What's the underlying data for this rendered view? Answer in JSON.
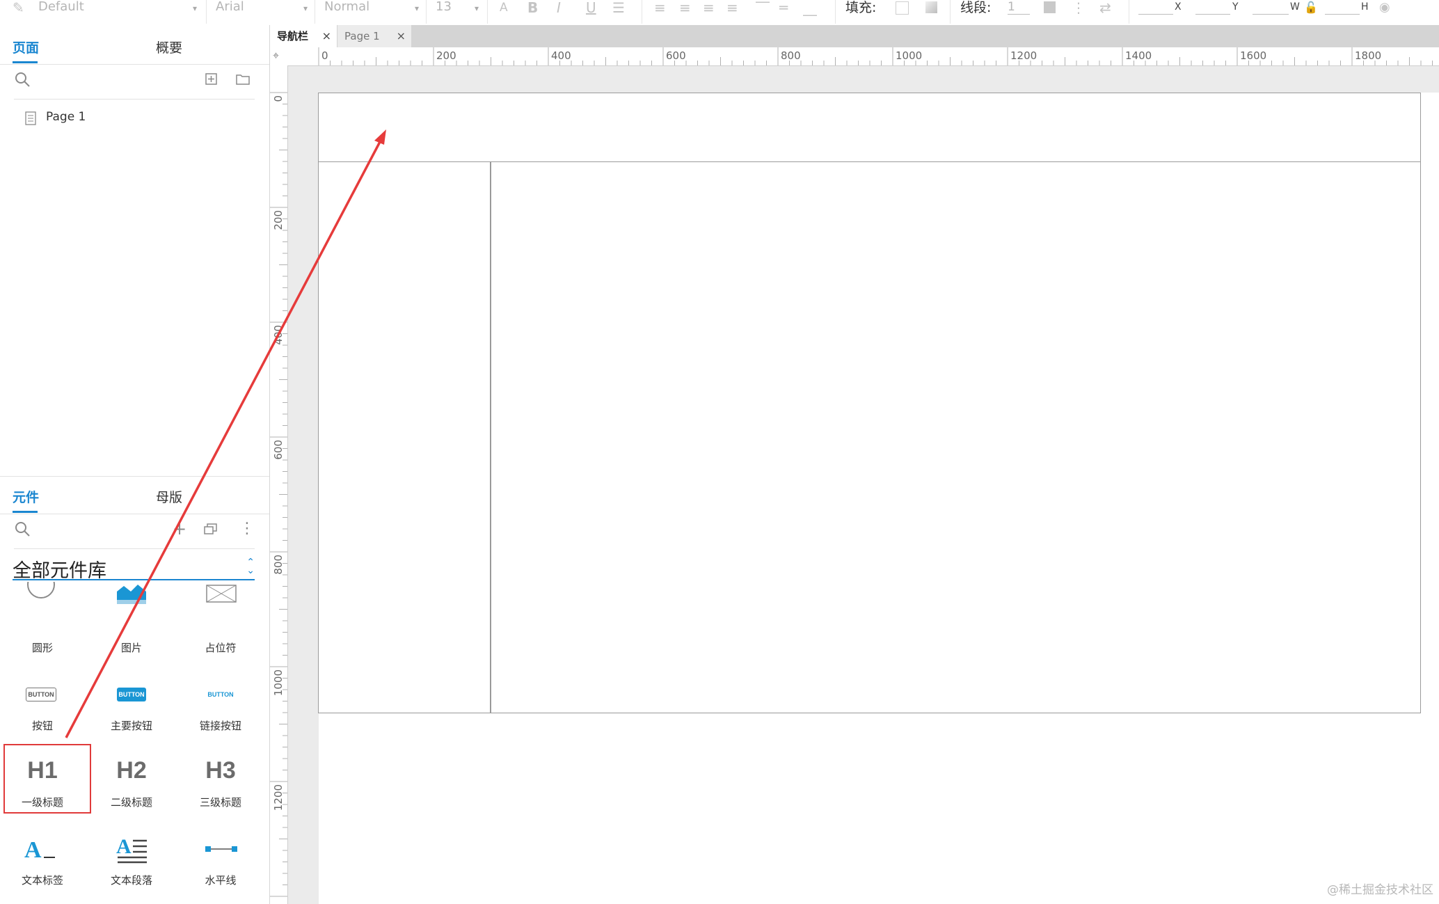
{
  "toolbar": {
    "style_dropdown": "Default",
    "font_dropdown": "Arial",
    "weight_dropdown": "Normal",
    "size_dropdown": "13",
    "fill_label": "填充:",
    "stroke_label": "线段:",
    "stroke_value": "1",
    "x_label": "X",
    "y_label": "Y",
    "w_label": "W",
    "h_label": "H"
  },
  "pages_panel": {
    "tab_pages": "页面",
    "tab_outline": "概要",
    "items": [
      "Page 1"
    ]
  },
  "library_panel": {
    "tab_widgets": "元件",
    "tab_masters": "母版",
    "library_name": "全部元件库",
    "widgets": [
      {
        "label": "圆形",
        "icon": "circle-icon"
      },
      {
        "label": "图片",
        "icon": "image-icon"
      },
      {
        "label": "占位符",
        "icon": "placeholder-icon"
      },
      {
        "label": "按钮",
        "icon": "button-icon",
        "glyph": "BUTTON"
      },
      {
        "label": "主要按钮",
        "icon": "primary-button-icon",
        "glyph": "BUTTON"
      },
      {
        "label": "链接按钮",
        "icon": "link-button-icon",
        "glyph": "BUTTON"
      },
      {
        "label": "一级标题",
        "icon": "h1-icon",
        "glyph": "H1"
      },
      {
        "label": "二级标题",
        "icon": "h2-icon",
        "glyph": "H2"
      },
      {
        "label": "三级标题",
        "icon": "h3-icon",
        "glyph": "H3"
      },
      {
        "label": "文本标签",
        "icon": "text-label-icon"
      },
      {
        "label": "文本段落",
        "icon": "text-paragraph-icon"
      },
      {
        "label": "水平线",
        "icon": "horizontal-line-icon"
      }
    ]
  },
  "doc_tabs": [
    {
      "label": "导航栏",
      "active": true
    },
    {
      "label": "Page 1",
      "active": false
    }
  ],
  "ruler_h": [
    "0",
    "200",
    "400",
    "600",
    "800",
    "1000",
    "1200",
    "1400",
    "1600",
    "1800"
  ],
  "ruler_v": [
    "0",
    "200",
    "400",
    "600",
    "800",
    "1000",
    "1200"
  ],
  "watermark": "@稀土掘金技术社区",
  "colors": {
    "accent": "#1a86d0",
    "highlight_box": "#e03a3a",
    "arrow": "#e63b3b"
  }
}
